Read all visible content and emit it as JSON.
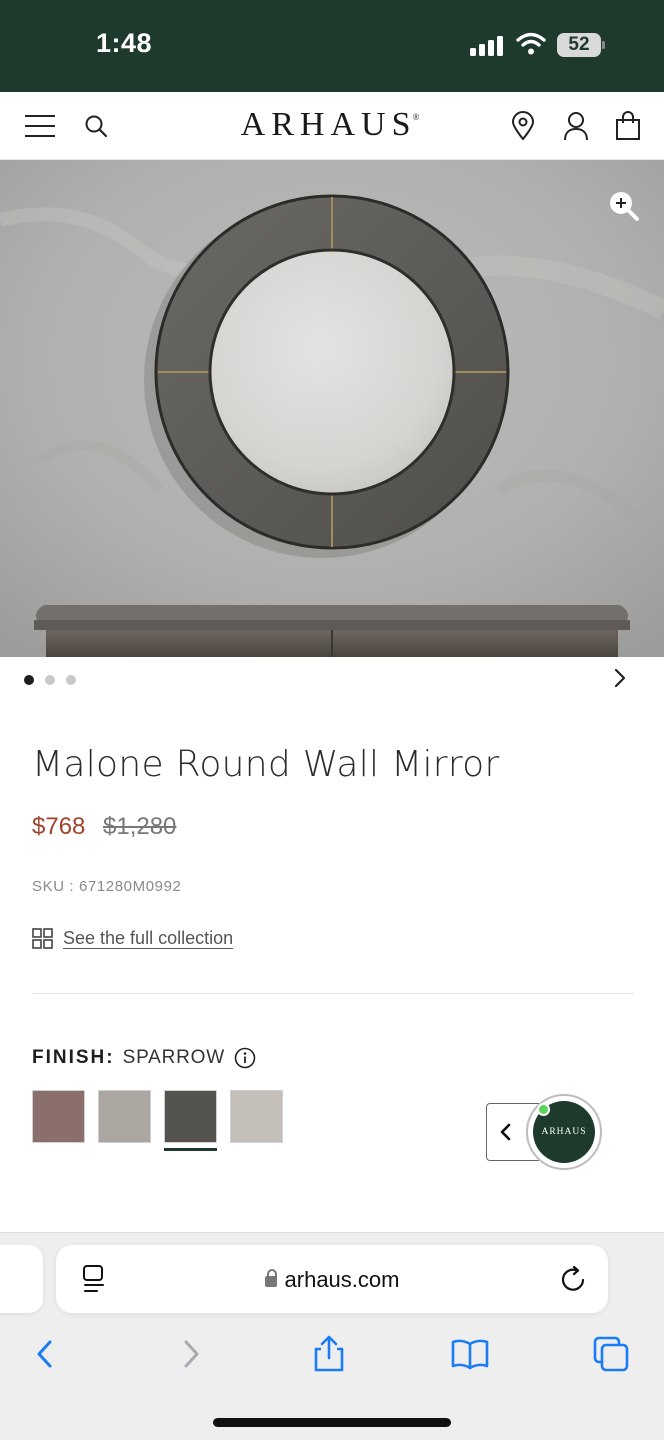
{
  "status_bar": {
    "time": "1:48",
    "battery": "52"
  },
  "header": {
    "logo": "ARHAUS",
    "logo_mark": "®",
    "icons": [
      "menu-icon",
      "search-icon",
      "location-pin-icon",
      "account-icon",
      "shopping-bag-icon"
    ]
  },
  "hero": {
    "slides_total": 3,
    "active_slide": 1
  },
  "product": {
    "title": "Malone Round Wall Mirror",
    "sale_price": "$768",
    "original_price": "$1,280",
    "sku": "SKU : 671280M0992",
    "collection_link": "See the full collection"
  },
  "finish": {
    "label": "FINISH:",
    "selected": "SPARROW",
    "swatches": [
      {
        "color": "#8a6f6c"
      },
      {
        "color": "#aca6a0"
      },
      {
        "color": "#55534d",
        "selected": true
      },
      {
        "color": "#c4bfb8"
      }
    ]
  },
  "chat_widget": {
    "brand": "ARHAUS",
    "online_color": "#5bd45b"
  },
  "browser": {
    "url": "arhaus.com"
  },
  "colors": {
    "brand_green": "#1e3a2c",
    "sale_red": "#a0432b"
  }
}
